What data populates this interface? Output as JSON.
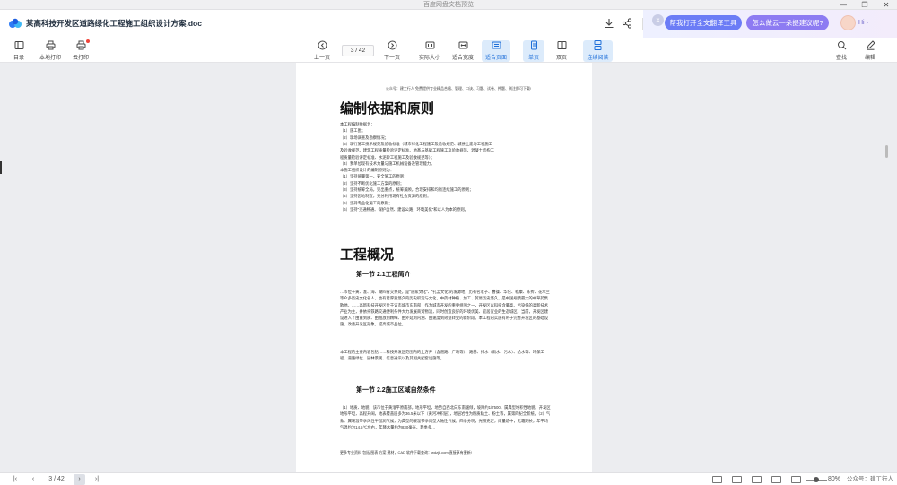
{
  "window": {
    "app_title": "百度网盘文档预览",
    "minimize": "—",
    "maximize": "❐",
    "close": "✕"
  },
  "document": {
    "title": "某高科技开发区道路绿化工程施工组织设计方案.doc"
  },
  "ai_bar": {
    "close": "×",
    "suggestion_1": "帮我打开全文翻译工具",
    "suggestion_2": "怎么做云一朵提建议呢?",
    "greeting": "Hi",
    "chevron": "›"
  },
  "toolbar": {
    "toc": "目录",
    "local_print": "本地打印",
    "cloud_print": "云打印",
    "prev_page": "上一页",
    "page_current": "3",
    "page_total": "42",
    "page_sep": "/",
    "next_page": "下一页",
    "actual_size": "实际大小",
    "fit_width": "适合宽度",
    "fit_page": "适合页面",
    "single_page": "单页",
    "double_page": "双页",
    "continuous": "连续阅读",
    "search": "查找",
    "edit": "编辑"
  },
  "page": {
    "header": "公众号：建工行人 免费提供专业精品合格、管理、口诀、习题、试卷、押题、刷注即可下载!",
    "section1_title": "编制依据和原则",
    "basis_lines": [
      "本工程编制依据为：",
      "（1）施工图；",
      "（2）现场调查及勘察情况；",
      "（3）现行施工技术规范及验收标准（城市绿化工程施工及验收规范、城县土建与工程施工",
      "及验收规范、建筑工程质量检验评定标准、地基与基础工程施工及验收规范、混凝土结构工",
      "程质量检验评定标准、水泥砂工程施工及验收规范等）；",
      "（4）我单位现有技术力量与施工机械设备及管理能力。",
      "本施工组织设计的编制原则为：",
      "（1）坚持质量第一，安全施工的原则；",
      "（2）坚持不断优化施工方案的原则；",
      "（3）坚持统筹全局，突出重点，统筹兼顾，合理安排和均衡连续施工的原则；",
      "（4）坚持因地制宜，充分利用现有社会资源的原则；",
      "（5）坚持专业化施工的原则；",
      "（6）坚持\"交通畅通、保护自然、建设公路，环境美化\"和以人为本的原则。"
    ],
    "section2_title": "工程概况",
    "sub1_title": "第一节 2.1工程简介",
    "intro_para": "…市位于黄、淮、海、湖四省交界处，是\"道家文化\"、\"孔孟文化\"的发源地，历有名老子、曹操、华佗、嵇康、陈抟、花木兰等众多历史文化名人，也有着厚重悠久的历史积淀与文化，中药材种植、加工、贸易历史悠久，是中国规模最大的中草药集散地。……高新科技开发区位于该市城市东南部，作为城市开发的重要组团之一，开发区以科技含量高、污染低的高新技术产业为主，并依托铁路交通便利条件大力发展商贸物流，同时创造良好的环境优美、宜居宜业的生态城区。当前，开发区建设进入了由量到质、由粗放到精细、由外延到内涵、由速度到效益转变的新阶段。本工程的实施有利于完善开发区的基础设施，改善开发区形象，提高城市品位。",
    "scope_para": "本工程的主要内容包括……科技开发区范围内的土方开（含道路、广场等）、路基、排水（雨水、污水）、给水等、环保工程、道路绿化、园林景观、信息通讯以及其相关配套设施等。",
    "sub2_title": "第一节 2.2施工区域自然条件",
    "nature_para": "（1）地质、地貌：该市位于黄淮平原南部，地形平坦，地势自西北向东南缓倾，坡降约1/7500。属典型堆积性地貌。开发区地形平坦，高程开阔，地表覆盖层多为36.5米以下（黄河冲积层），地层岩性为粉质粘土、粉土等，属第四纪全新统。（2）气象：属暖温带季风性半湿润气候，为典型的暖温带季风型大陆性气候，四季分明，光照充足，雨量适中，无霜期长，年平均气温约为14.5℃左右，年降水量约为830毫米，夏季多…",
    "footer": "更多专业资料 包括 图表 方案 建材，CAD 软件下载查询：wdzjk.com 直接享有更新!"
  },
  "status": {
    "first": "|‹",
    "prev": "‹",
    "page_current": "3",
    "page_sep": "/",
    "page_total": "42",
    "next": "›",
    "last": "›|",
    "zoom": "80%",
    "watermark": "公众号：建工行人"
  }
}
